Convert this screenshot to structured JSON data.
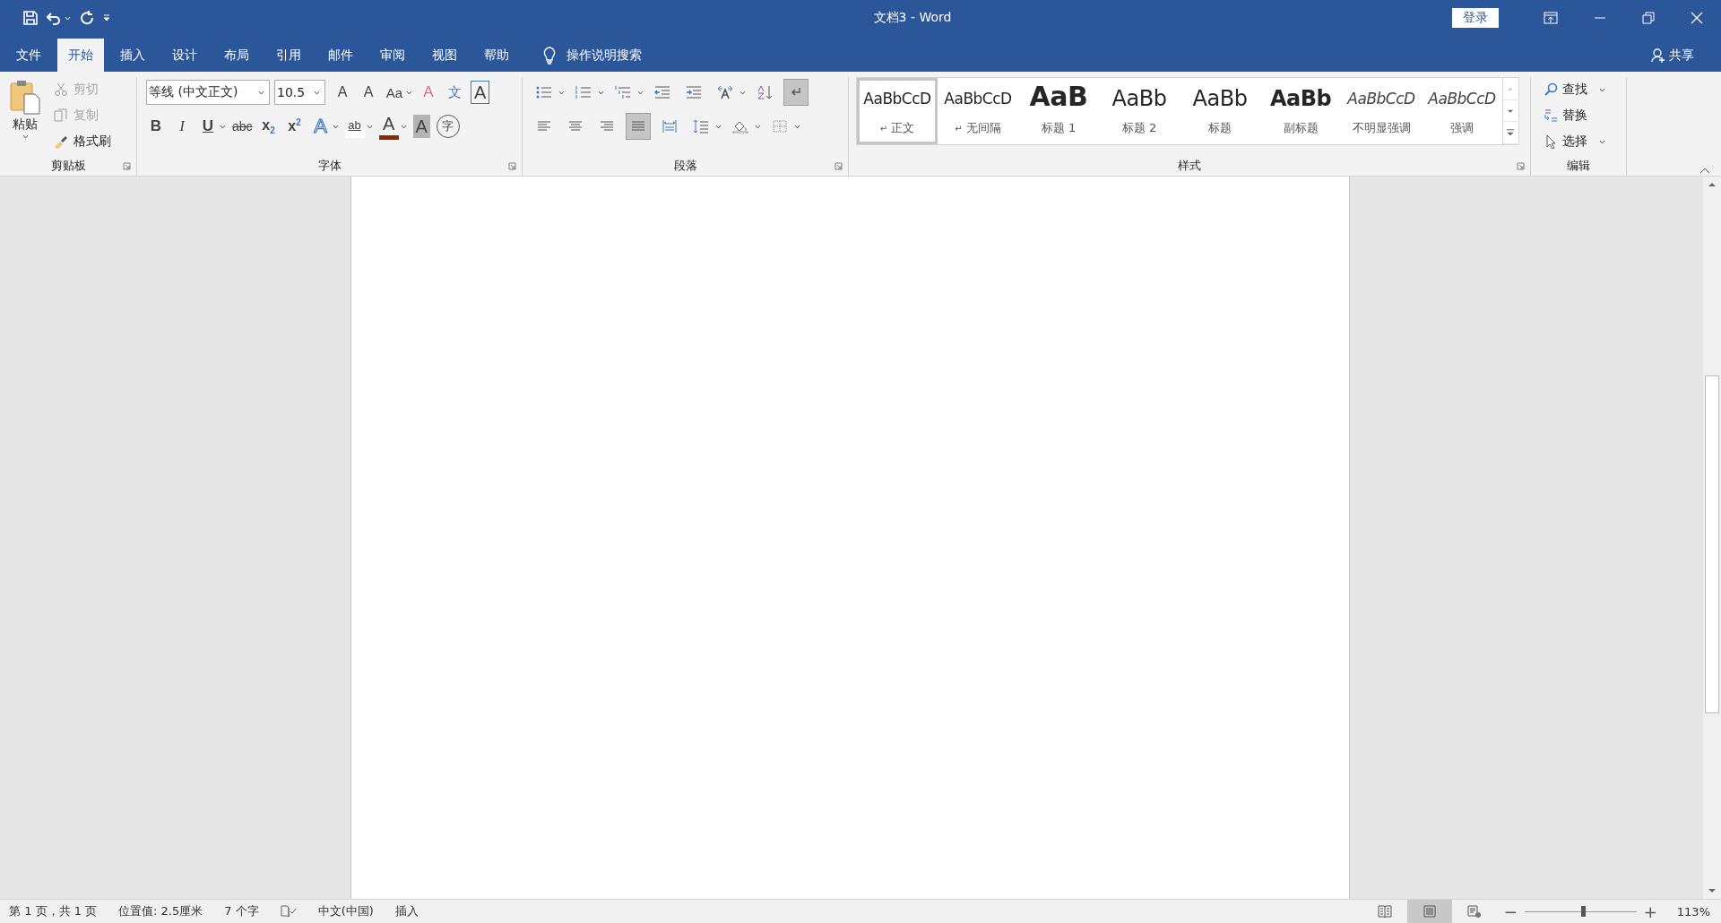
{
  "window": {
    "title": "文档3 - Word",
    "login": "登录"
  },
  "tabs": [
    {
      "label": "文件",
      "selected": false
    },
    {
      "label": "开始",
      "selected": true
    },
    {
      "label": "插入",
      "selected": false
    },
    {
      "label": "设计",
      "selected": false
    },
    {
      "label": "布局",
      "selected": false
    },
    {
      "label": "引用",
      "selected": false
    },
    {
      "label": "邮件",
      "selected": false
    },
    {
      "label": "审阅",
      "selected": false
    },
    {
      "label": "视图",
      "selected": false
    },
    {
      "label": "帮助",
      "selected": false
    }
  ],
  "tell_me": "操作说明搜索",
  "share": "共享",
  "clipboard": {
    "label": "剪贴板",
    "paste": "粘贴",
    "items": [
      {
        "kind": "cut",
        "label": "剪切",
        "disabled": true
      },
      {
        "kind": "copy",
        "label": "复制",
        "disabled": true
      },
      {
        "kind": "painter",
        "label": "格式刷",
        "disabled": false
      }
    ]
  },
  "font": {
    "label": "字体",
    "font_name": "等线 (中文正文)",
    "font_size": "10.5",
    "row1": [
      {
        "kind": "grow",
        "glyph": "A"
      },
      {
        "kind": "shrink",
        "glyph": "A"
      },
      {
        "kind": "case",
        "glyph": "Aa",
        "dropdown": true
      },
      {
        "kind": "clear",
        "glyph": "A"
      },
      {
        "kind": "phonetic",
        "glyph": "文"
      },
      {
        "kind": "border",
        "glyph": "A"
      }
    ],
    "row2": [
      {
        "kind": "bold",
        "glyph": "B"
      },
      {
        "kind": "italic",
        "glyph": "I"
      },
      {
        "kind": "underline",
        "glyph": "U",
        "dropdown": true
      },
      {
        "kind": "strike",
        "glyph": "abc"
      },
      {
        "kind": "plain",
        "glyph": "x$_{2}$"
      },
      {
        "kind": "plain",
        "glyph": "x$^{2}$"
      },
      {
        "kind": "effect",
        "glyph": "A",
        "dropdown": true
      },
      {
        "kind": "highlight",
        "glyph": "ab",
        "dropdown": true
      },
      {
        "kind": "color",
        "glyph": "A",
        "dropdown": true
      },
      {
        "kind": "shade",
        "glyph": "A"
      },
      {
        "kind": "enclose",
        "glyph": "字"
      }
    ]
  },
  "paragraph": {
    "label": "段落",
    "show_marks": true,
    "align": [
      {
        "selected": false
      },
      {
        "selected": false
      },
      {
        "selected": false
      },
      {
        "selected": true
      },
      {
        "selected": false
      }
    ]
  },
  "styles": {
    "label": "样式",
    "items": [
      {
        "kind": "normal",
        "sample": "AaBbCcD",
        "name": "正文",
        "mark": "↵",
        "selected": true
      },
      {
        "kind": "normal",
        "sample": "AaBbCcD",
        "name": "无间隔",
        "mark": "↵",
        "selected": false
      },
      {
        "kind": "h1",
        "sample": "AaB",
        "name": "标题 1",
        "selected": false
      },
      {
        "kind": "h2",
        "sample": "AaBb",
        "name": "标题 2",
        "selected": false
      },
      {
        "kind": "title",
        "sample": "AaBb",
        "name": "标题",
        "selected": false
      },
      {
        "kind": "subtitle",
        "sample": "AaBb",
        "name": "副标题",
        "selected": false
      },
      {
        "kind": "italic",
        "sample": "AaBbCcD",
        "name": "不明显强调",
        "selected": false
      },
      {
        "kind": "italic",
        "sample": "AaBbCcD",
        "name": "强调",
        "selected": false
      }
    ]
  },
  "editing": {
    "label": "编辑",
    "items": [
      {
        "kind": "find",
        "label": "查找",
        "dropdown": true
      },
      {
        "kind": "replace",
        "label": "替换",
        "dropdown": false
      },
      {
        "kind": "select",
        "label": "选择",
        "dropdown": true
      }
    ]
  },
  "status_bar": {
    "left": [
      {
        "kind": "text",
        "text": "第 1 页，共 1 页"
      },
      {
        "kind": "text",
        "text": "位置值: 2.5厘米"
      },
      {
        "kind": "text",
        "text": "7 个字"
      },
      {
        "kind": "proof"
      },
      {
        "kind": "text",
        "text": "中文(中国)"
      },
      {
        "kind": "text",
        "text": "插入"
      }
    ],
    "views": [
      {
        "kind": "read",
        "selected": false
      },
      {
        "kind": "print",
        "selected": true
      },
      {
        "kind": "web",
        "selected": false
      }
    ],
    "zoom_out": "−",
    "zoom_in": "+",
    "zoom": {
      "level": 0.52
    },
    "zoom_text": "113%"
  }
}
